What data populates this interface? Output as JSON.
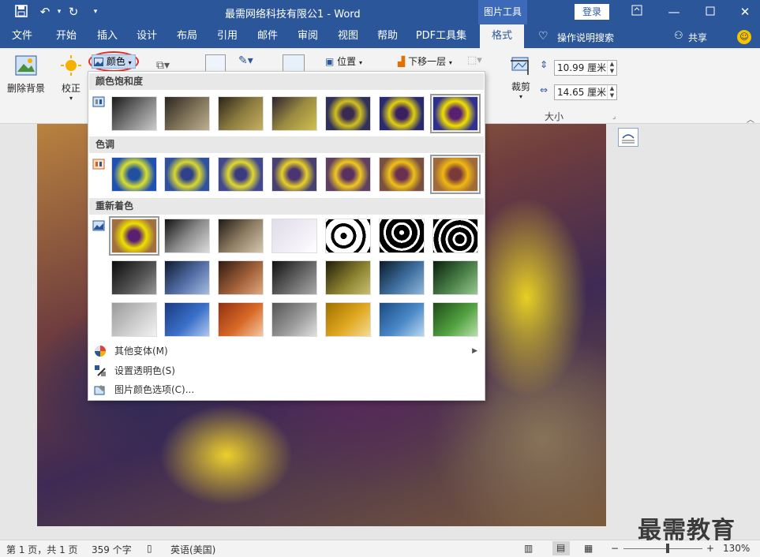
{
  "titlebar": {
    "title": "最需网络科技有限公1  -  Word",
    "context_tab": "图片工具",
    "login": "登录"
  },
  "tabs": [
    "文件",
    "开始",
    "插入",
    "设计",
    "布局",
    "引用",
    "邮件",
    "审阅",
    "视图",
    "帮助",
    "PDF工具集",
    "格式"
  ],
  "active_tab": "格式",
  "tell_me": "操作说明搜索",
  "share": "共享",
  "ribbon": {
    "remove_bg": "删除背景",
    "correct": "校正",
    "color": "颜色",
    "position": "位置",
    "send_back": "下移一层",
    "crop": "裁剪",
    "height_value": "10.99 厘米",
    "width_value": "14.65 厘米",
    "size_group": "大小"
  },
  "gallery": {
    "section_saturation": "颜色饱和度",
    "section_tone": "色调",
    "section_recolor": "重新着色",
    "menu_more": "其他变体(M)",
    "menu_transparent": "设置透明色(S)",
    "menu_options": "图片颜色选项(C)...",
    "selected_saturation_index": 6,
    "selected_tone_index": 6,
    "selected_recolor_index": 0
  },
  "status": {
    "page": "第 1 页，共 1 页",
    "words": "359 个字",
    "language": "英语(美国)",
    "zoom": "130%"
  },
  "watermark": "最需教育",
  "colors": {
    "accent": "#2b579a",
    "ribbon_bg": "#f3f3f3"
  }
}
